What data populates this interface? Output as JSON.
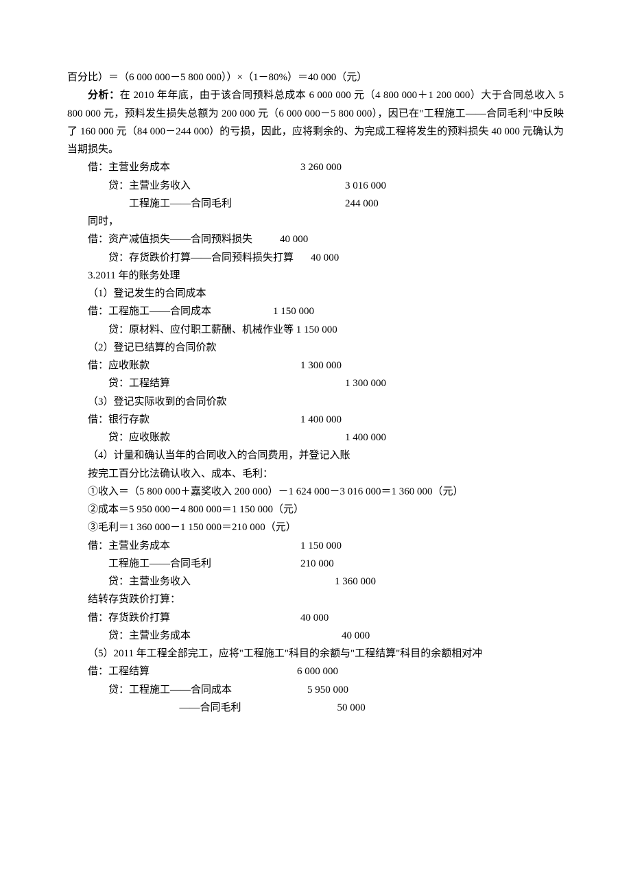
{
  "p1": "百分比）＝（6 000 000－5 800 000））×（1－80%）＝40 000（元）",
  "p2a": "分析：",
  "p2b": "在 2010 年年底，由于该合同预料总成本 6 000 000 元（4 800 000＋1 200 000）大于合同总收入 5 800 000 元，预料发生损失总额为 200 000 元（6 000 000－5 800 000），因已在\"工程施工——合同毛利\"中反映了 160 000 元（84 000－244 000）的亏损，因此，应将剩余的、为完成工程将发生的预料损失 40 000 元确认为当期损失。",
  "e1": {
    "label": "借：主营业务成本",
    "amount": "3 260 000"
  },
  "e2": {
    "label": "贷：主营业务收入",
    "amount": "3 016 000"
  },
  "e3": {
    "label": "工程施工——合同毛利",
    "amount": "244 000"
  },
  "p3": "同时，",
  "e4": {
    "label": "借：资产减值损失——合同预料损失",
    "amount": "40 000"
  },
  "e5": {
    "label": "贷：存货跌价打算——合同预料损失打算",
    "amount": "40 000"
  },
  "p4": "3.2011 年的账务处理",
  "p5": "（1）登记发生的合同成本",
  "e6": {
    "label": "借：工程施工——合同成本",
    "amount": "1 150 000"
  },
  "e7": {
    "label": "贷：原材料、应付职工薪酬、机械作业等 1 150 000"
  },
  "p6": "（2）登记已结算的合同价款",
  "e8": {
    "label": "借：应收账款",
    "amount": "1 300 000"
  },
  "e9": {
    "label": "贷：工程结算",
    "amount": "1 300 000"
  },
  "p7": "（3）登记实际收到的合同价款",
  "e10": {
    "label": "借：银行存款",
    "amount": "1 400 000"
  },
  "e11": {
    "label": "贷：应收账款",
    "amount": "1 400 000"
  },
  "p8": "（4）计量和确认当年的合同收入的合同费用，并登记入账",
  "p9": "按完工百分比法确认收入、成本、毛利：",
  "p10": "①收入＝（5 800 000＋嘉奖收入 200 000）－1 624 000－3 016 000＝1 360 000（元）",
  "p11": "②成本＝5 950 000－4 800 000＝1 150 000（元）",
  "p12": "③毛利＝1 360 000－1 150 000＝210 000（元）",
  "e12": {
    "label": "借：主营业务成本",
    "amount": "1 150 000"
  },
  "e13": {
    "label": "工程施工——合同毛利",
    "amount": "210 000"
  },
  "e14": {
    "label": "贷：主营业务收入",
    "amount": "1 360 000"
  },
  "p13": "结转存货跌价打算：",
  "e15": {
    "label": "借：存货跌价打算",
    "amount": "40 000"
  },
  "e16": {
    "label": "贷：主营业务成本",
    "amount": "40 000"
  },
  "p14": "（5）2011 年工程全部完工，应将\"工程施工\"科目的余额与\"工程结算\"科目的余额相对冲",
  "e17": {
    "label": "借：工程结算",
    "amount": "6 000 000"
  },
  "e18": {
    "label": "贷：工程施工——合同成本",
    "amount": "5 950 000"
  },
  "e19": {
    "label": "——合同毛利",
    "amount": "50 000"
  }
}
